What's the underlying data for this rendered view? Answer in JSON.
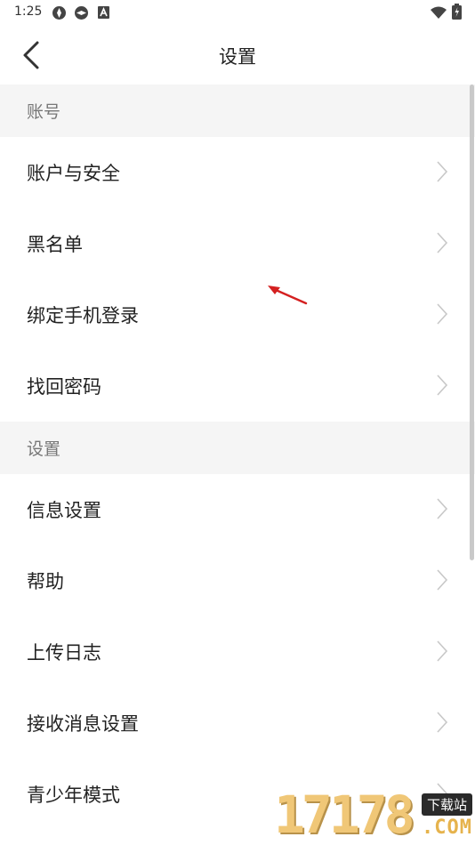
{
  "status_bar": {
    "time": "1:25",
    "left_icons": [
      "sync-icon",
      "sync-icon",
      "a-badge-icon"
    ],
    "right_icons": [
      "wifi-icon",
      "battery-icon"
    ]
  },
  "header": {
    "back_icon": "chevron-left-icon",
    "title": "设置"
  },
  "sections": [
    {
      "title": "账号",
      "items": [
        {
          "label": "账户与安全"
        },
        {
          "label": "黑名单"
        },
        {
          "label": "绑定手机登录"
        },
        {
          "label": "找回密码"
        }
      ]
    },
    {
      "title": "设置",
      "items": [
        {
          "label": "信息设置"
        },
        {
          "label": "帮助"
        },
        {
          "label": "上传日志"
        },
        {
          "label": "接收消息设置"
        },
        {
          "label": "青少年模式"
        }
      ]
    }
  ],
  "watermark": {
    "number": "17178",
    "badge": "下载站",
    "domain": ".COM"
  },
  "colors": {
    "section_bg": "#f5f5f5",
    "annotation_arrow": "#d42020",
    "watermark": "#f0c777"
  }
}
